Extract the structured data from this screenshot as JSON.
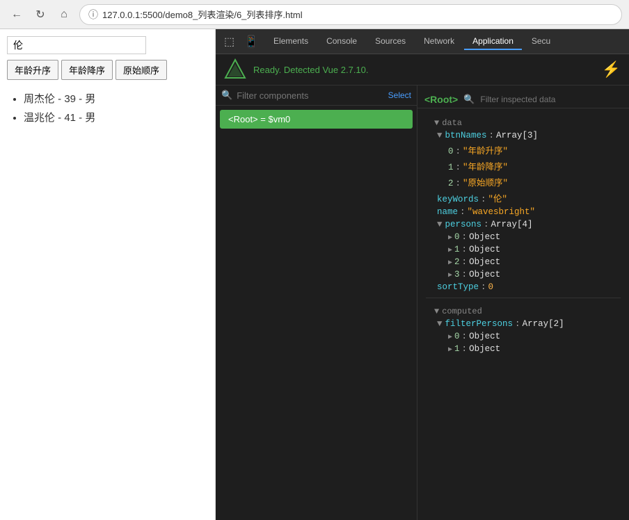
{
  "browser": {
    "url": "127.0.0.1:5500/demo8_列表渲染/6_列表排序.html",
    "back_label": "←",
    "refresh_label": "↻",
    "home_label": "⌂",
    "info_label": "ⓘ"
  },
  "app": {
    "search_placeholder": "伦",
    "search_value": "伦",
    "buttons": [
      "年龄升序",
      "年龄降序",
      "原始顺序"
    ],
    "persons": [
      "周杰伦 - 39 - 男",
      "温兆伦 - 41 - 男"
    ]
  },
  "devtools": {
    "tabs": [
      "Elements",
      "Console",
      "Sources",
      "Network",
      "Application",
      "Secu"
    ],
    "active_tab": "Application",
    "vue": {
      "status": "Ready. Detected Vue 2.7.10.",
      "search_placeholder": "Filter components",
      "select_label": "Select",
      "root_component": "<Root> = $vm0",
      "root_tag": "<Root>",
      "filter_data_placeholder": "Filter inspected data",
      "sections": {
        "data": {
          "label": "data",
          "items": [
            {
              "key": "btnNames",
              "value": "Array[3]",
              "children": [
                {
                  "index": "0",
                  "value": "\"年龄升序\""
                },
                {
                  "index": "1",
                  "value": "\"年龄降序\""
                },
                {
                  "index": "2",
                  "value": "\"原始顺序\""
                }
              ]
            },
            {
              "key": "keyWords",
              "value": "\"伦\""
            },
            {
              "key": "name",
              "value": "\"wavesbright\""
            },
            {
              "key": "persons",
              "value": "Array[4]",
              "children": [
                {
                  "index": "0",
                  "value": "Object"
                },
                {
                  "index": "1",
                  "value": "Object"
                },
                {
                  "index": "2",
                  "value": "Object"
                },
                {
                  "index": "3",
                  "value": "Object"
                }
              ]
            },
            {
              "key": "sortType",
              "value": "0"
            }
          ]
        },
        "computed": {
          "label": "computed",
          "items": [
            {
              "key": "filterPersons",
              "value": "Array[2]",
              "children": [
                {
                  "index": "0",
                  "value": "Object"
                },
                {
                  "index": "1",
                  "value": "Object"
                }
              ]
            }
          ]
        }
      }
    }
  }
}
